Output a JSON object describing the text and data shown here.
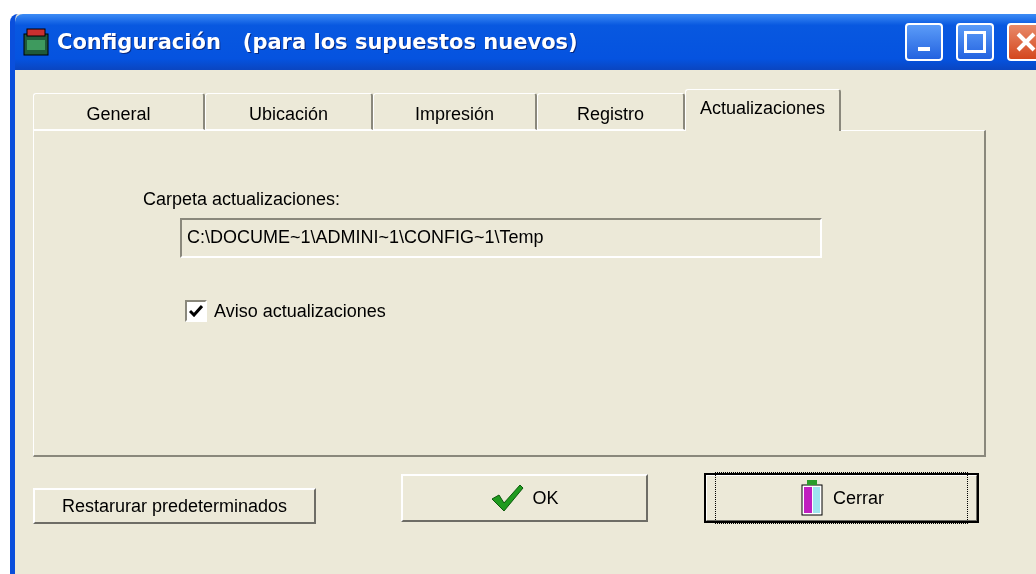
{
  "window": {
    "title": "Configuración   (para los supuestos nuevos)"
  },
  "tabs": [
    {
      "label": "General",
      "selected": false
    },
    {
      "label": "Ubicación",
      "selected": false
    },
    {
      "label": "Impresión",
      "selected": false
    },
    {
      "label": "Registro",
      "selected": false
    },
    {
      "label": "Actualizaciones",
      "selected": true
    }
  ],
  "panel": {
    "folder_label": "Carpeta actualizaciones:",
    "folder_value": "C:\\DOCUME~1\\ADMINI~1\\CONFIG~1\\Temp",
    "notify": {
      "label": "Aviso actualizaciones",
      "checked": true
    }
  },
  "buttons": [
    {
      "kind": "plain",
      "label": "Restarurar predeterminados",
      "focused": false
    },
    {
      "kind": "ok",
      "label": "OK",
      "focused": false
    },
    {
      "kind": "close",
      "label": "Cerrar",
      "focused": true
    }
  ]
}
